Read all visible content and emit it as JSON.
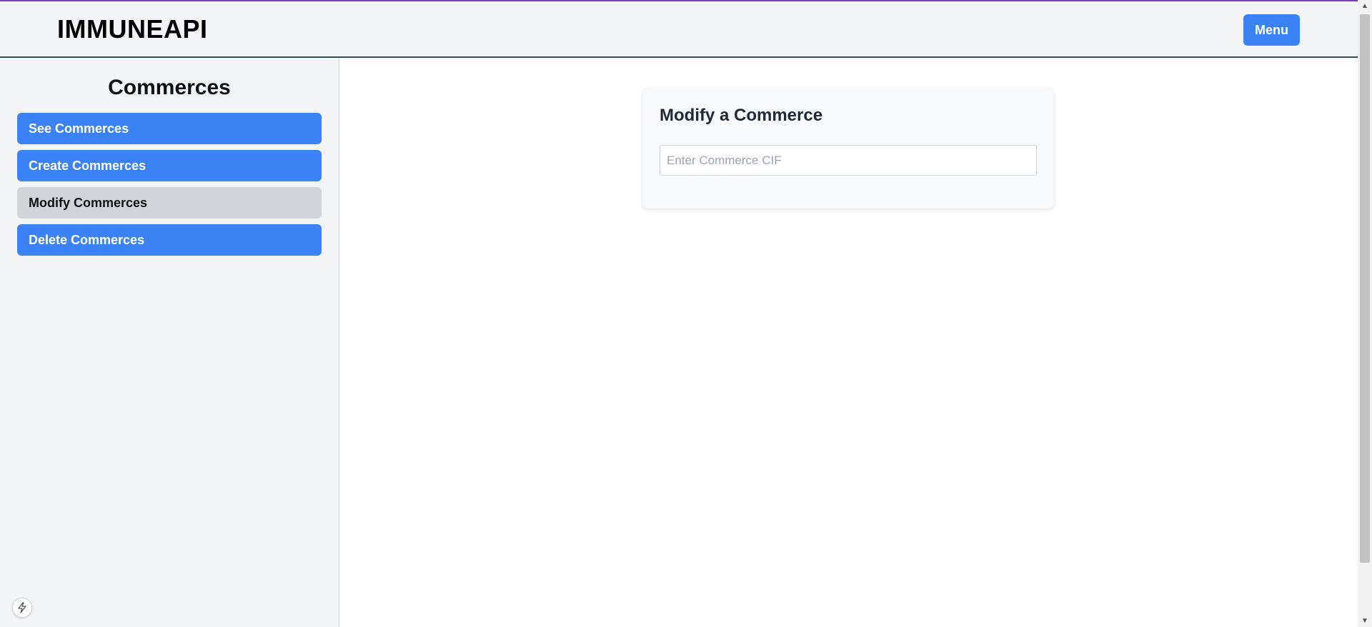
{
  "header": {
    "logo": "IMMUNEAPI",
    "menu_label": "Menu"
  },
  "sidebar": {
    "title": "Commerces",
    "items": [
      {
        "label": "See Commerces",
        "state": "default"
      },
      {
        "label": "Create Commerces",
        "state": "default"
      },
      {
        "label": "Modify Commerces",
        "state": "active"
      },
      {
        "label": "Delete Commerces",
        "state": "default"
      }
    ]
  },
  "main": {
    "card_title": "Modify a Commerce",
    "cif_input": {
      "placeholder": "Enter Commerce CIF",
      "value": ""
    }
  },
  "icons": {
    "floating_badge": "lightning-bolt-icon",
    "scroll_up": "scroll-up-arrow-icon",
    "scroll_down": "scroll-down-arrow-icon"
  },
  "colors": {
    "accent": "#3b82f6",
    "active_item": "#d1d5db",
    "top_border": "#7e3fbf",
    "header_divider": "#2f4f4f"
  }
}
